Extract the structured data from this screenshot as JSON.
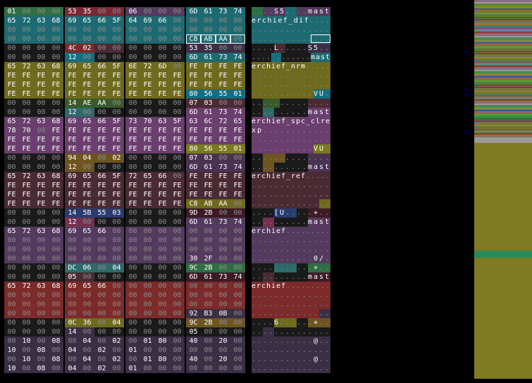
{
  "palette": {
    "0": "#1a1a1a",
    "1": "#3d1a26",
    "2": "#3a2f45",
    "3": "#4a3352",
    "4": "#533a5e",
    "5": "#4a2a33",
    "6": "#7a2836",
    "7": "#2e6e44",
    "8": "#1e6a72",
    "9": "#6a3e6e",
    "a": "#6e6a1e",
    "b": "#7a7a1e",
    "c": "#136e80",
    "d": "#7c2a2a",
    "e": "#2a3c6e",
    "f": "#5a3044",
    "g": "#3a5a2a",
    "h": "#6e5520",
    "i": "#76304e",
    "j": "#2f6a6a"
  },
  "hex_rows": [
    {
      "b": "01 00 00 00 53 35 00 00 06 00 00 00 6D 61 73 74",
      "c": "7777666644448888"
    },
    {
      "b": "65 72 63 68 69 65 66 5F 64 69 66 00 00 00 00 00",
      "c": "8888888888888888"
    },
    {
      "b": "00 00 00 00 00 00 00 00 00 00 00 00 00 00 00 00",
      "c": "8888888888888888"
    },
    {
      "b": "00 00 00 00 00 00 00 00 00 00 00 00 C8 AB AA 00",
      "c": "8888888888888888"
    },
    {
      "b": "00 00 00 00 4C 02 00 00 00 00 00 00 53 35 00 00",
      "c": "0000dd5500002222"
    },
    {
      "b": "00 00 00 00 12 00 00 00 00 00 00 00 6D 61 73 74",
      "c": "0000cc0000008888"
    },
    {
      "b": "65 72 63 68 69 65 66 5F 6E 72 6D 00 FE FE FE FE",
      "c": "aaaaaaaaaaaaaaaa"
    },
    {
      "b": "FE FE FE FE FE FE FE FE FE FE FE FE FE FE FE FE",
      "c": "aaaaaaaaaaaaaaaa"
    },
    {
      "b": "FE FE FE FE FE FE FE FE FE FE FE FE FE FE FE FE",
      "c": "aaaaaaaaaaaaaaaa"
    },
    {
      "b": "FE FE FE FE FE FE FE FE FE FE FE FE 80 56 55 01",
      "c": "aaaaaaaaaaaacccc"
    },
    {
      "b": "00 00 00 00 14 AE AA 00 00 00 00 00 07 03 00 00",
      "c": "0000gggg00005555"
    },
    {
      "b": "00 00 00 00 12 00 00 00 00 00 00 00 6D 61 73 74",
      "c": "0000jj0000009999"
    },
    {
      "b": "65 72 63 68 69 65 66 5F 73 70 63 5F 63 6C 72 65",
      "c": "9999999999999999"
    },
    {
      "b": "78 70 00 FE FE FE FE FE FE FE FE FE FE FE FE FE",
      "c": "9999999999999999"
    },
    {
      "b": "FE FE FE FE FE FE FE FE FE FE FE FE FE FE FE FE",
      "c": "9999999999999999"
    },
    {
      "b": "FE FE FE FE FE FE FE FE FE FE FE FE 80 56 55 01",
      "c": "999999999999bbbb"
    },
    {
      "b": "00 00 00 00 94 04 00 02 00 00 00 00 07 03 00 00",
      "c": "0000hhhh00003333"
    },
    {
      "b": "00 00 00 00 12 00 00 00 00 00 00 00 6D 61 73 74",
      "c": "0000hh0000003333"
    },
    {
      "b": "65 72 63 68 69 65 66 5F 72 65 66 00 FE FE FE FE",
      "c": "5555555555555555"
    },
    {
      "b": "FE FE FE FE FE FE FE FE FE FE FE FE FE FE FE FE",
      "c": "5555555555555555"
    },
    {
      "b": "FE FE FE FE FE FE FE FE FE FE FE FE FE FE FE FE",
      "c": "5555555555555555"
    },
    {
      "b": "FE FE FE FE FE FE FE FE FE FE FE FE C8 AB AA 00",
      "c": "555555555555aaaa"
    },
    {
      "b": "00 00 00 00 14 5B 55 03 00 00 00 00 9D 2B 00 00",
      "c": "0000eeee00001111"
    },
    {
      "b": "00 00 00 00 12 00 00 00 00 00 00 00 6D 61 73 74",
      "c": "0000ii0000004444"
    },
    {
      "b": "65 72 63 68 69 65 66 00 00 00 00 00 00 00 00 00",
      "c": "4444444444444444"
    },
    {
      "b": "00 00 00 00 00 00 00 00 00 00 00 00 00 00 00 00",
      "c": "4444444444444444"
    },
    {
      "b": "00 00 00 00 00 00 00 00 00 00 00 00 00 00 00 00",
      "c": "4444444444444444"
    },
    {
      "b": "00 00 00 00 00 00 00 00 00 00 00 00 30 2F 00 00",
      "c": "4444444444444444"
    },
    {
      "b": "00 00 00 00 DC 06 00 04 00 00 00 00 9C 2B 00 00",
      "c": "0000jjjj00007777"
    },
    {
      "b": "00 00 00 00 05 00 00 00 00 00 00 00 6D 61 73 74",
      "c": "0000550000001111"
    },
    {
      "b": "65 72 63 68 69 65 66 00 00 00 00 00 00 00 00 00",
      "c": "dddddddddddddddd"
    },
    {
      "b": "00 00 00 00 00 00 00 00 00 00 00 00 00 00 00 00",
      "c": "dddddddddddddddd"
    },
    {
      "b": "00 00 00 00 00 00 00 00 00 00 00 00 00 00 00 00",
      "c": "dddddddddddddddd"
    },
    {
      "b": "00 00 00 00 00 00 00 00 00 00 00 00 92 B3 0B 00",
      "c": "dddddddddddd2222"
    },
    {
      "b": "00 00 00 00 0C 36 00 04 00 00 00 00 9C 2B 00 00",
      "c": "0000aaaa0000hhhh"
    },
    {
      "b": "00 00 00 00 14 00 00 00 00 00 00 00 05 00 00 00",
      "c": "0000220000000000"
    },
    {
      "b": "00 10 00 08 00 04 00 02 00 01 80 00 40 00 20 00",
      "c": "2222222222222222"
    },
    {
      "b": "10 00 08 00 04 00 02 00 01 00 00 00 00 00 00 00",
      "c": "2222222222222222"
    },
    {
      "b": "00 10 00 08 00 04 00 02 00 01 80 00 40 00 20 00",
      "c": "2222222222222222"
    },
    {
      "b": "10 00 08 00 04 00 02 00 01 00 00 00 00 00 00 00",
      "c": "2222222222222222"
    }
  ],
  "ascii_rows": [
    {
      "t": "....S5....mast",
      "c": "77444488444444"
    },
    {
      "t": "erchief_dif....",
      "c": "888888888888888"
    },
    {
      "t": "..............",
      "c": "88888888888888"
    },
    {
      "t": "..............",
      "c": "88888888888888"
    },
    {
      "t": "....L.....S5..",
      "c": "00005500002222"
    },
    {
      "t": "....\u0012.......mast",
      "c": "0000cc0000008888"
    },
    {
      "t": "erchief_nrm.....",
      "c": "aaaaaaaaaaaaaaaa"
    },
    {
      "t": "..............",
      "c": "aaaaaaaaaaaaaa"
    },
    {
      "t": "..............",
      "c": "aaaaaaaaaaaaaa"
    },
    {
      "t": "...........VU.",
      "c": "aaaaaaaaaaaccc"
    },
    {
      "t": "..............",
      "c": "00ggg000005555"
    },
    {
      "t": "..........mast",
      "c": "00jj0000009999"
    },
    {
      "t": "erchief_spc_clre",
      "c": "9999999999999999"
    },
    {
      "t": "xp............",
      "c": "99999999999999"
    },
    {
      "t": "..............",
      "c": "99999999999999"
    },
    {
      "t": "...........VU.",
      "c": "99999999999bbb"
    },
    {
      "t": "..............",
      "c": "00hhhh00003333"
    },
    {
      "t": "..........mast",
      "c": "00hh0000003333"
    },
    {
      "t": "erchief_ref.....",
      "c": "5555555555555555"
    },
    {
      "t": "..............",
      "c": "55555555555555"
    },
    {
      "t": "..............",
      "c": "55555555555555"
    },
    {
      "t": "..............",
      "c": "555555555555aa"
    },
    {
      "t": "....[U.....+..",
      "c": "0000eeee001111"
    },
    {
      "t": "..........mast",
      "c": "00ii0000004444"
    },
    {
      "t": "erchief.........",
      "c": "4444444444444444"
    },
    {
      "t": "..............",
      "c": "44444444444444"
    },
    {
      "t": "..............",
      "c": "44444444444444"
    },
    {
      "t": "...........0/.",
      "c": "44444444444444"
    },
    {
      "t": "...........+..",
      "c": "0000jjjj007777"
    },
    {
      "t": "..........mast",
      "c": "00550000001111"
    },
    {
      "t": "erchief.........",
      "c": "dddddddddddddddd"
    },
    {
      "t": "..............",
      "c": "dddddddddddddd"
    },
    {
      "t": "..............",
      "c": "dddddddddddddd"
    },
    {
      "t": "..............",
      "c": "dddddddddddd22"
    },
    {
      "t": "....6......+..",
      "c": "0000aaaa00hhhh"
    },
    {
      "t": "..............",
      "c": "00220000000000"
    },
    {
      "t": "...........@..",
      "c": "22222222222222"
    },
    {
      "t": "..............",
      "c": "22222222222222"
    },
    {
      "t": "...........@..",
      "c": "22222222222222"
    },
    {
      "t": "..............",
      "c": "22222222222222"
    }
  ],
  "minimap_colors": [
    "#8a6a8a",
    "#2a8a5a",
    "#5a8a9a",
    "#9a5a6a",
    "#3a7a8a",
    "#8a8a3a",
    "#6a6a9a",
    "#9a9a9a",
    "#2a6a3a",
    "#8a3a3a",
    "#5a9a3a",
    "#7a4a8a",
    "#3a5a9a",
    "#9a7a3a",
    "#4a8a4a",
    "#6a3a6a"
  ]
}
